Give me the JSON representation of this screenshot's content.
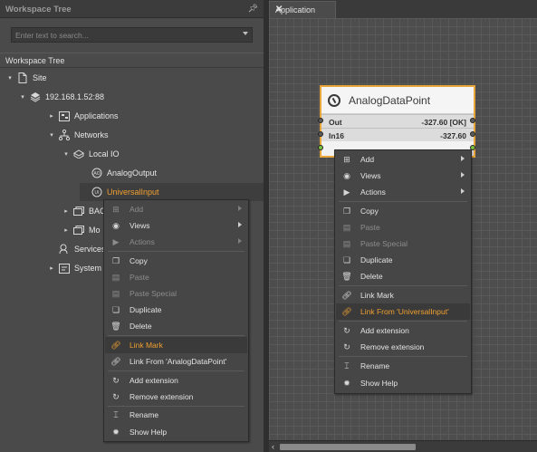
{
  "left_panel": {
    "title": "Workspace Tree",
    "pin": "ᵰ",
    "search_placeholder": "Enter text to search...",
    "tree_title": "Workspace Tree",
    "tree": [
      {
        "label": "Site",
        "icon": "page-icon"
      },
      {
        "label": "192.168.1.52:88",
        "icon": "server-icon"
      },
      {
        "label": "Applications",
        "icon": "applications-icon"
      },
      {
        "label": "Networks",
        "icon": "networks-icon"
      },
      {
        "label": "Local IO",
        "icon": "local-io-icon"
      },
      {
        "label": "AnalogOutput",
        "icon": "analog-output-icon"
      },
      {
        "label": "UniversalInput",
        "icon": "universal-input-icon"
      },
      {
        "label": "BAC",
        "icon": "bacnet-icon"
      },
      {
        "label": "Mo",
        "icon": "modbus-icon"
      },
      {
        "label": "Services",
        "icon": "services-icon"
      },
      {
        "label": "System",
        "icon": "system-icon"
      }
    ]
  },
  "tab": {
    "label": "Application",
    "close": "✕"
  },
  "block": {
    "title": "AnalogDataPoint",
    "slots": [
      {
        "name": "Out",
        "value": "-327.60 [OK]"
      },
      {
        "name": "In16",
        "value": "-327.60"
      }
    ]
  },
  "tree_menu": {
    "items": [
      {
        "label": "Add",
        "icon": "add-icon",
        "disabled": true,
        "submenu": true
      },
      {
        "label": "Views",
        "icon": "views-icon",
        "disabled": false,
        "submenu": true
      },
      {
        "label": "Actions",
        "icon": "actions-icon",
        "disabled": true,
        "submenu": true
      },
      {
        "label": "Copy",
        "icon": "copy-icon",
        "disabled": false
      },
      {
        "label": "Paste",
        "icon": "paste-icon",
        "disabled": true
      },
      {
        "label": "Paste Special",
        "icon": "paste-special-icon",
        "disabled": true
      },
      {
        "label": "Duplicate",
        "icon": "duplicate-icon",
        "disabled": false
      },
      {
        "label": "Delete",
        "icon": "delete-icon",
        "disabled": false
      },
      {
        "label": "Link Mark",
        "icon": "link-icon",
        "disabled": false,
        "highlight": true
      },
      {
        "label": "Link From 'AnalogDataPoint'",
        "icon": "link-from-icon",
        "disabled": false
      },
      {
        "label": "Add extension",
        "icon": "add-extension-icon",
        "disabled": false
      },
      {
        "label": "Remove extension",
        "icon": "remove-extension-icon",
        "disabled": false
      },
      {
        "label": "Rename",
        "icon": "rename-icon",
        "disabled": false
      },
      {
        "label": "Show Help",
        "icon": "help-icon",
        "disabled": false
      }
    ]
  },
  "canvas_menu": {
    "items": [
      {
        "label": "Add",
        "icon": "add-icon",
        "disabled": false,
        "submenu": true
      },
      {
        "label": "Views",
        "icon": "views-icon",
        "disabled": false,
        "submenu": true
      },
      {
        "label": "Actions",
        "icon": "actions-icon",
        "disabled": false,
        "submenu": true
      },
      {
        "label": "Copy",
        "icon": "copy-icon",
        "disabled": false
      },
      {
        "label": "Paste",
        "icon": "paste-icon",
        "disabled": true
      },
      {
        "label": "Paste Special",
        "icon": "paste-special-icon",
        "disabled": true
      },
      {
        "label": "Duplicate",
        "icon": "duplicate-icon",
        "disabled": false
      },
      {
        "label": "Delete",
        "icon": "delete-icon",
        "disabled": false
      },
      {
        "label": "Link Mark",
        "icon": "link-icon",
        "disabled": false
      },
      {
        "label": "Link From 'UniversalInput'",
        "icon": "link-from-icon",
        "disabled": false,
        "highlight": true
      },
      {
        "label": "Add extension",
        "icon": "add-extension-icon",
        "disabled": false
      },
      {
        "label": "Remove extension",
        "icon": "remove-extension-icon",
        "disabled": false
      },
      {
        "label": "Rename",
        "icon": "rename-icon",
        "disabled": false
      },
      {
        "label": "Show Help",
        "icon": "help-icon",
        "disabled": false
      }
    ]
  },
  "colors": {
    "accent": "#f0a030",
    "selection_border": "#e8a53a",
    "panel_bg": "#4a4a4a"
  }
}
